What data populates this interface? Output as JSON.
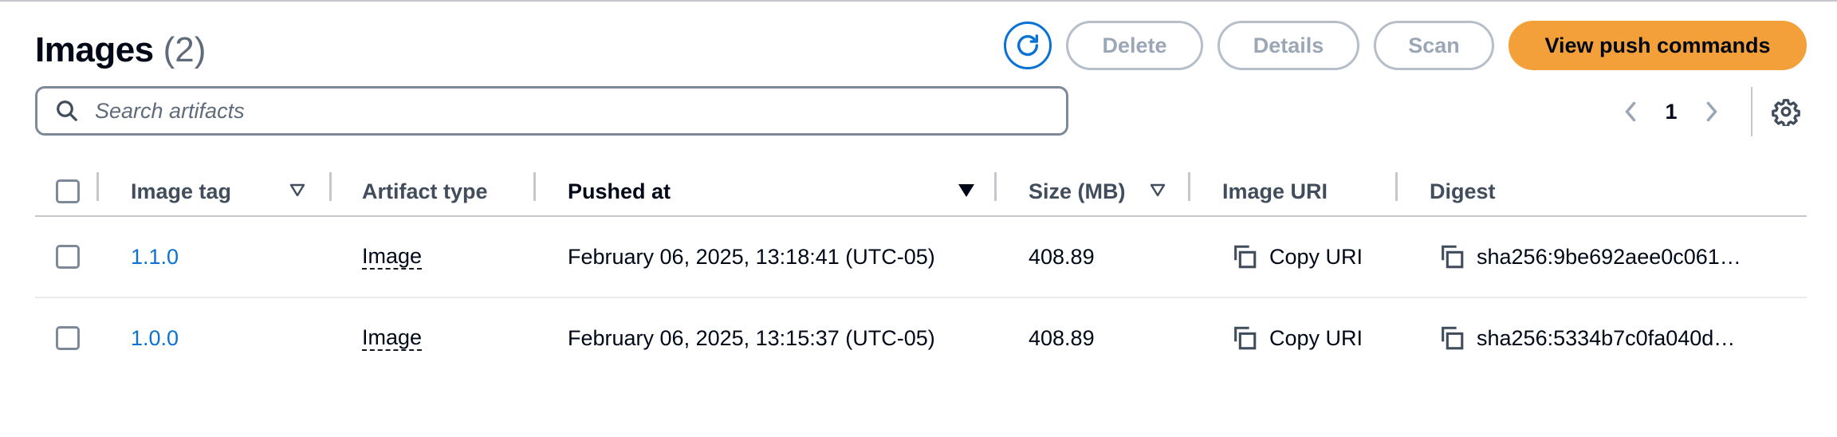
{
  "header": {
    "title": "Images",
    "count": "(2)"
  },
  "actions": {
    "delete_label": "Delete",
    "details_label": "Details",
    "scan_label": "Scan",
    "push_label": "View push commands"
  },
  "search": {
    "placeholder": "Search artifacts",
    "value": ""
  },
  "pagination": {
    "current_page": "1"
  },
  "table": {
    "columns": {
      "image_tag": "Image tag",
      "artifact_type": "Artifact type",
      "pushed_at": "Pushed at",
      "size": "Size (MB)",
      "image_uri": "Image URI",
      "digest": "Digest"
    },
    "rows": [
      {
        "tag": "1.1.0",
        "type": "Image",
        "pushed": "February 06, 2025, 13:18:41 (UTC-05)",
        "size": "408.89",
        "uri_action": "Copy URI",
        "digest": "sha256:9be692aee0c061…"
      },
      {
        "tag": "1.0.0",
        "type": "Image",
        "pushed": "February 06, 2025, 13:15:37 (UTC-05)",
        "size": "408.89",
        "uri_action": "Copy URI",
        "digest": "sha256:5334b7c0fa040d…"
      }
    ]
  },
  "colors": {
    "accent": "#0972d3",
    "primary_button": "#f3a03a",
    "disabled_text": "#9ba7b6",
    "divider": "#c6c6cd"
  },
  "icons": [
    "refresh-icon",
    "search-icon",
    "chevron-left-icon",
    "chevron-right-icon",
    "settings-gear-icon",
    "sort-icon",
    "copy-icon"
  ]
}
